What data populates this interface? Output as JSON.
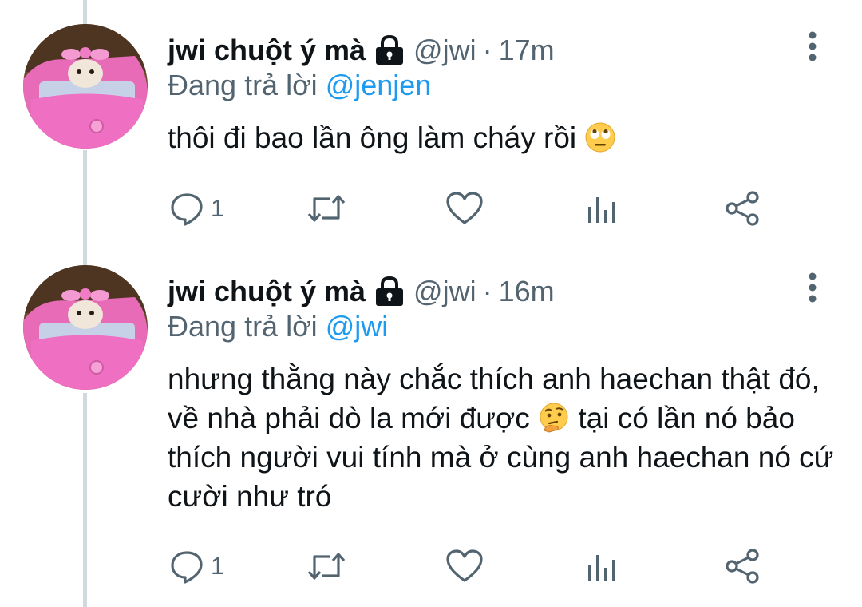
{
  "tweets": [
    {
      "display_name": "jwi chuột ý mà",
      "handle": "@jwi",
      "separator": "·",
      "time": "17m",
      "reply_prefix": "Đang trả lời ",
      "reply_mention": "@jenjen",
      "body_lines": [
        "thôi đi bao lần ông làm cháy rồi"
      ],
      "body_emoji": "face-with-rolling-eyes",
      "reply_count": "1"
    },
    {
      "display_name": "jwi chuột ý mà",
      "handle": "@jwi",
      "separator": "·",
      "time": "16m",
      "reply_prefix": "Đang trả lời ",
      "reply_mention": "@jwi",
      "body_part1": "nhưng thằng này chắc thích anh haechan thật đó, về nhà phải dò la mới được",
      "body_emoji": "thinking-face",
      "body_part2": "tại có lần nó bảo thích người vui tính mà ở cùng anh haechan nó cứ cười như tró",
      "reply_count": "1"
    }
  ],
  "icons": {
    "lock": "lock-icon",
    "more": "more-vertical-icon",
    "reply": "reply-icon",
    "retweet": "retweet-icon",
    "like": "heart-icon",
    "views": "views-icon",
    "share": "share-icon"
  },
  "colors": {
    "text": "#0f1419",
    "secondary": "#536471",
    "mention": "#1d9bf0",
    "thread_line": "#cfd9de",
    "background": "#ffffff"
  }
}
